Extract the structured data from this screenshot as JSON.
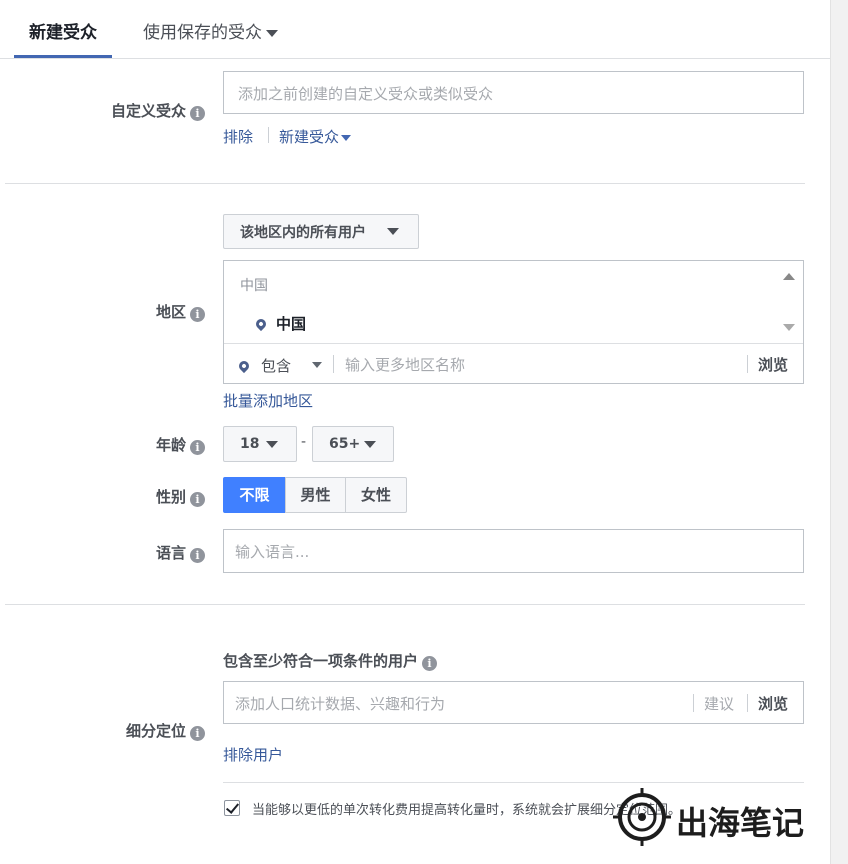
{
  "tabs": {
    "new_audience": "新建受众",
    "saved_audience": "使用保存的受众"
  },
  "custom_audience": {
    "label": "自定义受众",
    "placeholder": "添加之前创建的自定义受众或类似受众",
    "exclude": "排除",
    "create_new": "新建受众"
  },
  "location": {
    "label": "地区",
    "scope_dropdown": "该地区内的所有用户",
    "country_header": "中国",
    "selected_item": "中国",
    "include_dropdown": "包含",
    "input_placeholder": "输入更多地区名称",
    "browse": "浏览",
    "bulk_add": "批量添加地区"
  },
  "age": {
    "label": "年龄",
    "min": "18",
    "separator": "-",
    "max": "65+"
  },
  "gender": {
    "label": "性别",
    "options": [
      "不限",
      "男性",
      "女性"
    ],
    "selected": "不限"
  },
  "language": {
    "label": "语言",
    "placeholder": "输入语言..."
  },
  "detailed_targeting": {
    "label": "细分定位",
    "include_header": "包含至少符合一项条件的用户",
    "input_placeholder": "添加人口统计数据、兴趣和行为",
    "suggestions": "建议",
    "browse": "浏览",
    "exclude_people": "排除用户",
    "expansion_text": "当能够以更低的单次转化费用提高转化量时，系统就会扩展细分定位范围。",
    "expansion_checked": true
  },
  "watermark": {
    "text": "出海笔记"
  },
  "colors": {
    "accent": "#4267b2",
    "link": "#365899",
    "selected_bg": "#4080ff"
  }
}
